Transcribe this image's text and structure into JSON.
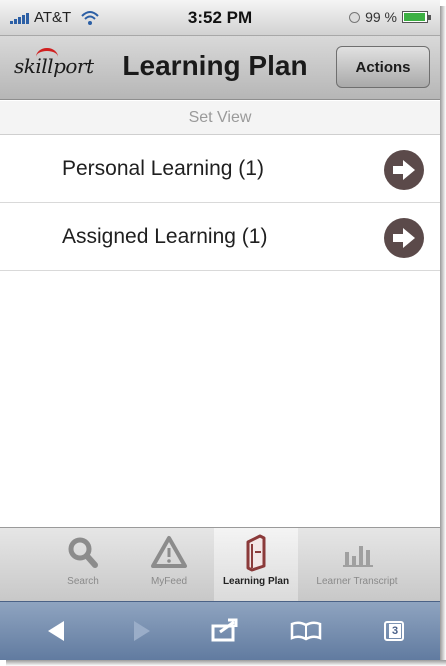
{
  "status_bar": {
    "carrier": "AT&T",
    "time": "3:52 PM",
    "battery": "99 %"
  },
  "header": {
    "logo": "skillport",
    "title": "Learning Plan",
    "actions_label": "Actions"
  },
  "set_view_label": "Set View",
  "items": [
    {
      "label": "Personal Learning (1)"
    },
    {
      "label": "Assigned Learning (1)"
    }
  ],
  "tabs": [
    {
      "label": "Search",
      "icon": "search-icon"
    },
    {
      "label": "MyFeed",
      "icon": "warning-icon"
    },
    {
      "label": "Learning Plan",
      "icon": "learning-plan-icon",
      "active": true
    },
    {
      "label": "Learner Transcript",
      "icon": "bar-chart-icon"
    }
  ],
  "browser_toolbar": {
    "tab_count": "3"
  },
  "colors": {
    "logo_accent": "#d01f1f",
    "arrow_button": "#5b4a4a",
    "learning_plan_icon": "#8b3a3a",
    "safari_toolbar": "#7088ab"
  }
}
